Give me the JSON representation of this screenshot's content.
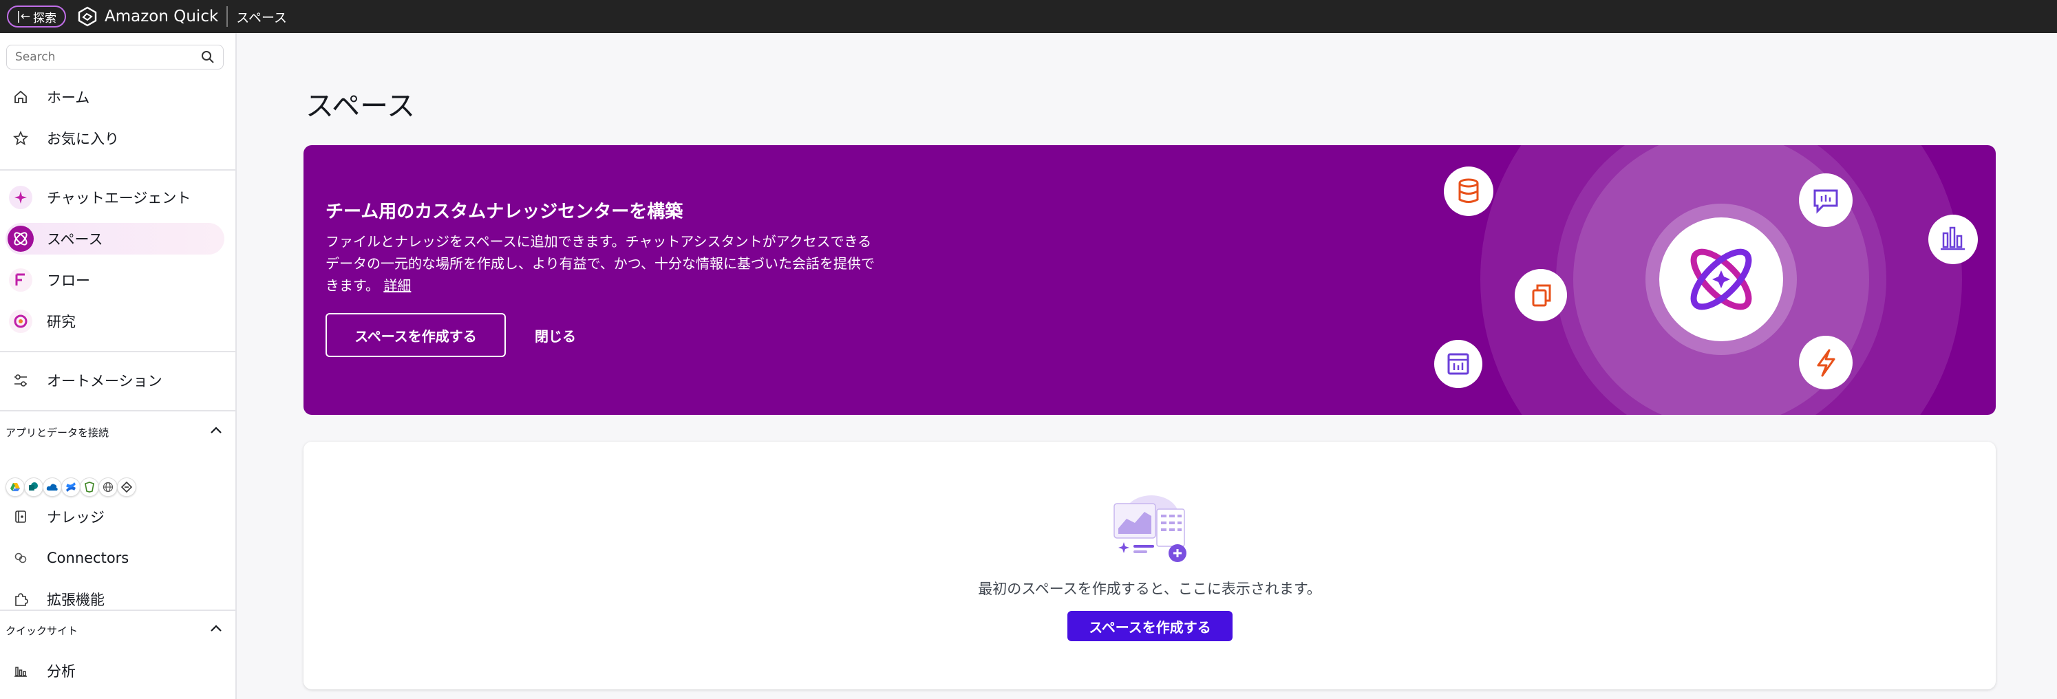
{
  "topbar": {
    "explore_label": "探索",
    "app_name": "Amazon Quick",
    "breadcrumb": "スペース"
  },
  "sidebar": {
    "search_placeholder": "Search",
    "items_top": [
      {
        "label": "ホーム",
        "icon": "home-icon"
      },
      {
        "label": "お気に入り",
        "icon": "star-icon"
      }
    ],
    "items_agents": [
      {
        "label": "チャットエージェント",
        "icon": "chat-agent-icon"
      },
      {
        "label": "スペース",
        "icon": "spaces-icon",
        "active": true
      },
      {
        "label": "フロー",
        "icon": "flows-icon"
      },
      {
        "label": "研究",
        "icon": "research-icon"
      }
    ],
    "automation": {
      "label": "オートメーション",
      "icon": "automation-icon"
    },
    "connect_section": {
      "title": "アプリとデータを接続",
      "apps": [
        "google-drive-icon",
        "sharepoint-icon",
        "onedrive-icon",
        "confluence-icon",
        "s3-icon",
        "web-crawler-icon",
        "custom-connector-icon"
      ]
    },
    "items_knowledge": [
      {
        "label": "ナレッジ",
        "icon": "knowledge-icon"
      },
      {
        "label": "Connectors",
        "icon": "connectors-icon"
      },
      {
        "label": "拡張機能",
        "icon": "extensions-icon"
      }
    ],
    "quicksight_section": {
      "title": "クイックサイト",
      "items": [
        {
          "label": "分析",
          "icon": "analysis-icon"
        }
      ]
    }
  },
  "main": {
    "page_title": "スペース",
    "banner": {
      "title": "チーム用のカスタムナレッジセンターを構築",
      "description": "ファイルとナレッジをスペースに追加できます。チャットアシスタントがアクセスできるデータの一元的な場所を作成し、より有益で、かつ、十分な情報に基づいた会話を提供できます。",
      "learn_more": "詳細",
      "create_button": "スペースを作成する",
      "close_button": "閉じる",
      "color": "#7c0190"
    },
    "empty_state": {
      "message": "最初のスペースを作成すると、ここに表示されます。",
      "create_button": "スペースを作成する",
      "button_color": "#4710e0"
    }
  }
}
